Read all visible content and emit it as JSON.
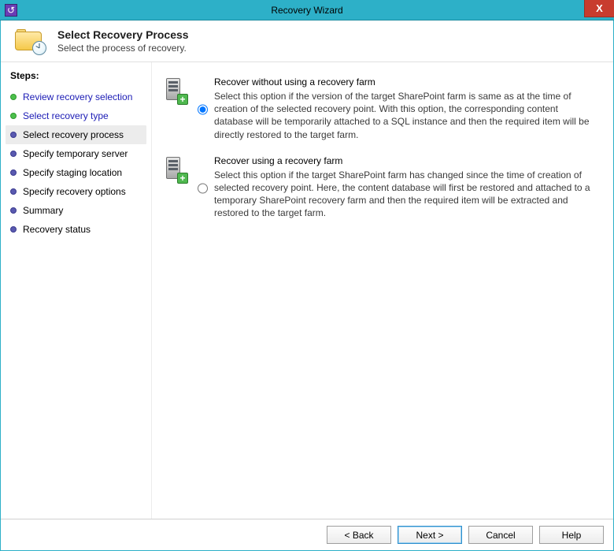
{
  "window": {
    "title": "Recovery Wizard"
  },
  "header": {
    "title": "Select Recovery Process",
    "subtitle": "Select the process of recovery."
  },
  "sidebar": {
    "title": "Steps:",
    "items": [
      {
        "label": "Review recovery selection",
        "state": "done"
      },
      {
        "label": "Select recovery type",
        "state": "done"
      },
      {
        "label": "Select recovery process",
        "state": "current"
      },
      {
        "label": "Specify temporary server",
        "state": "pending"
      },
      {
        "label": "Specify staging location",
        "state": "pending"
      },
      {
        "label": "Specify recovery options",
        "state": "pending"
      },
      {
        "label": "Summary",
        "state": "pending"
      },
      {
        "label": "Recovery status",
        "state": "pending"
      }
    ]
  },
  "options": [
    {
      "title": "Recover without using a recovery farm",
      "description": "Select this option if the version of the target SharePoint farm is same as at the time of creation of the selected recovery point. With this option, the corresponding content database will be temporarily attached to a SQL instance and then the required item will be directly restored to the target farm.",
      "selected": true
    },
    {
      "title": "Recover using a recovery farm",
      "description": "Select this option if the target SharePoint farm has changed since the time of creation of selected recovery point. Here, the content database will first be restored and attached to a temporary SharePoint recovery farm and then the required item will be extracted and restored to the target farm.",
      "selected": false
    }
  ],
  "buttons": {
    "back": "< Back",
    "next": "Next >",
    "cancel": "Cancel",
    "help": "Help"
  }
}
